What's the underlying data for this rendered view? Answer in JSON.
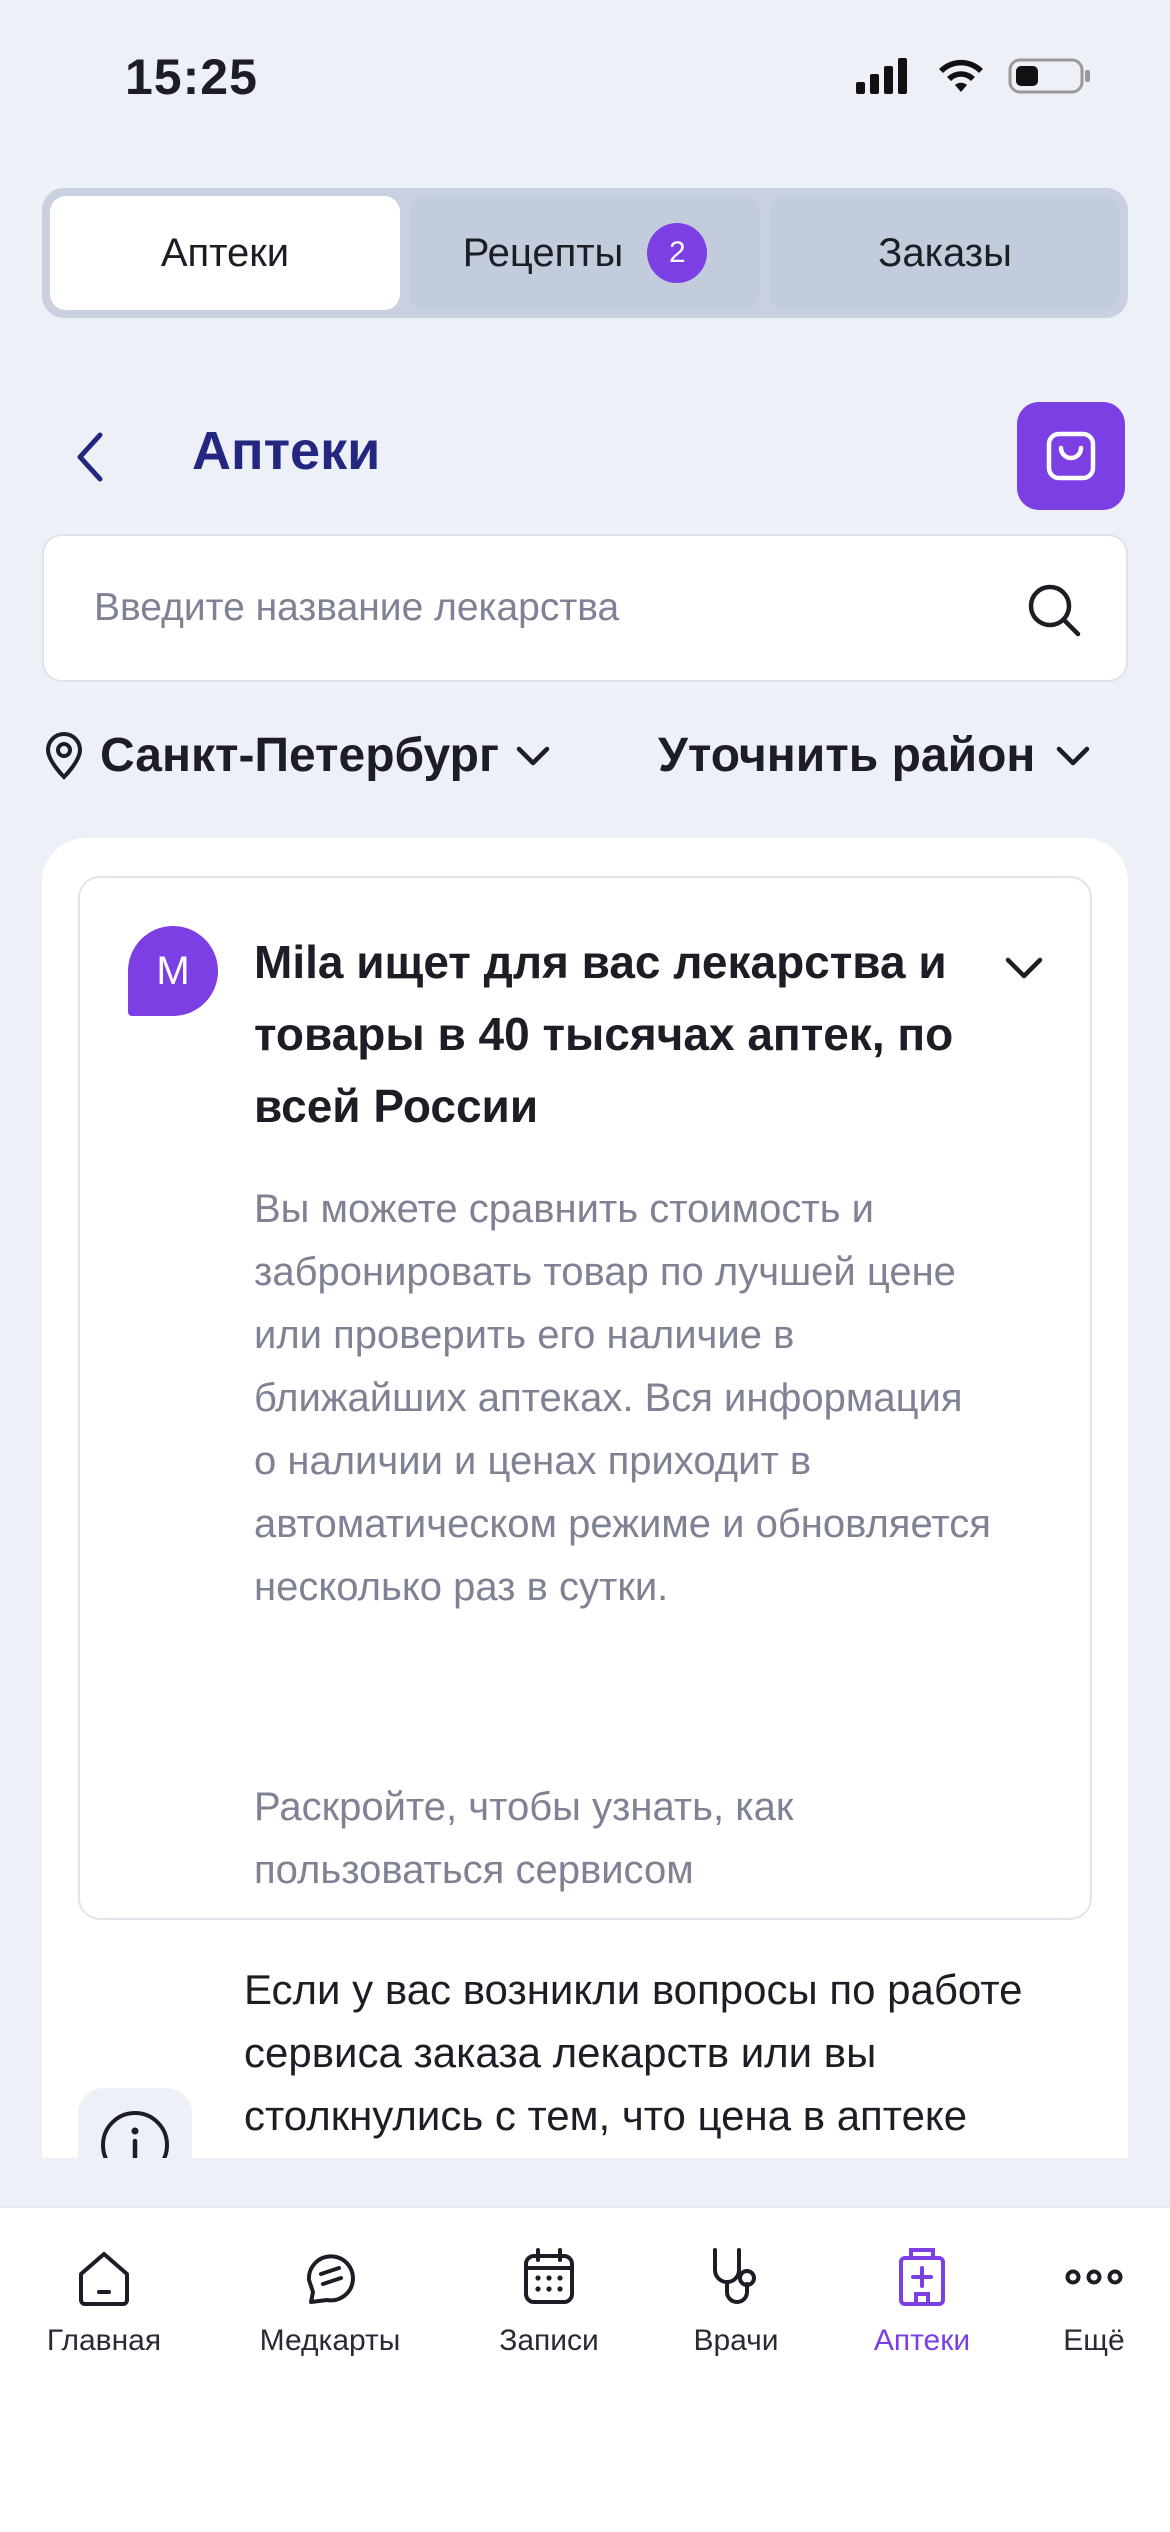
{
  "status_bar": {
    "time": "15:25"
  },
  "segmented_tabs": [
    {
      "label": "Аптеки",
      "active": true
    },
    {
      "label": "Рецепты",
      "badge": "2",
      "active": false
    },
    {
      "label": "Заказы",
      "active": false
    }
  ],
  "header": {
    "title": "Аптеки"
  },
  "search": {
    "placeholder": "Введите название лекарства",
    "value": ""
  },
  "location": {
    "city": "Санкт-Петербург",
    "district": "Уточнить район"
  },
  "info_card": {
    "avatar_letter": "M",
    "title": "Mila ищет для вас лекарства и товары в 40 тысячах аптек, по всей России",
    "text": "Вы можете сравнить стоимость и забронировать товар по лучшей цене или проверить его наличие в ближайших аптеках. Вся информация о наличии и ценах приходит в автоматическом режиме и обновляется несколько раз в сутки.",
    "hint": "Раскройте, чтобы узнать, как пользоваться сервисом"
  },
  "help_block": {
    "text": "Если у вас возникли вопросы по работе сервиса заказа лекарств или вы столкнулись с тем, что цена в аптеке"
  },
  "tabbar": {
    "items": [
      {
        "label": "Главная",
        "icon": "home-icon"
      },
      {
        "label": "Медкарты",
        "icon": "medcard-icon"
      },
      {
        "label": "Записи",
        "icon": "calendar-icon"
      },
      {
        "label": "Врачи",
        "icon": "stethoscope-icon"
      },
      {
        "label": "Аптеки",
        "icon": "pharmacy-icon",
        "active": true
      },
      {
        "label": "Ещё",
        "icon": "more-icon"
      }
    ]
  },
  "colors": {
    "accent": "#7b3fe4",
    "title": "#23277f",
    "background": "#eef0f7"
  }
}
